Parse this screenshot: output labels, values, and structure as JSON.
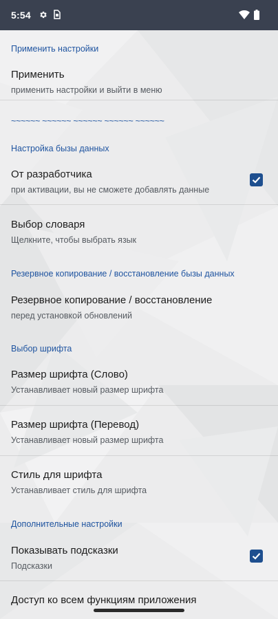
{
  "status_bar": {
    "time": "5:54",
    "icons": [
      "gear-icon",
      "sim-card-icon",
      "wifi-icon",
      "battery-icon"
    ]
  },
  "colors": {
    "status_bar_bg": "#3a4150",
    "section_header": "#1f54a0",
    "checkbox": "#1e4f8f"
  },
  "sections": {
    "apply": "Применить настройки",
    "dashes": "~~~~~~ ~~~~~~ ~~~~~~ ~~~~~~ ~~~~~~",
    "database": "Настройка бызы данных",
    "backup": "Резервное копирование / восстановление бызы данных",
    "font": "Выбор шрифта",
    "extra": "Дополнительные настройки"
  },
  "prefs": {
    "apply": {
      "title": "Применить",
      "summary": "применить настройки и выйти в меню"
    },
    "developer": {
      "title": "От разработчика",
      "summary": "при активации, вы не сможете добавлять данные",
      "checked": true
    },
    "dictionary": {
      "title": "Выбор словаря",
      "summary": "Щелкните, чтобы выбрать язык"
    },
    "backup": {
      "title": "Резервное копирование / восстановление",
      "summary": "перед установкой обновлений"
    },
    "font_word": {
      "title": "Размер шрифта (Слово)",
      "summary": "Устанавливает новый размер шрифта"
    },
    "font_translation": {
      "title": "Размер шрифта (Перевод)",
      "summary": "Устанавливает новый размер шрифта"
    },
    "font_style": {
      "title": "Стиль для шрифта",
      "summary": "Устанавливает стиль для шрифта"
    },
    "hints": {
      "title": "Показывать подсказки",
      "summary": "Подсказки",
      "checked": true
    },
    "all_features": {
      "title": "Доступ ко всем функциям приложения"
    }
  }
}
